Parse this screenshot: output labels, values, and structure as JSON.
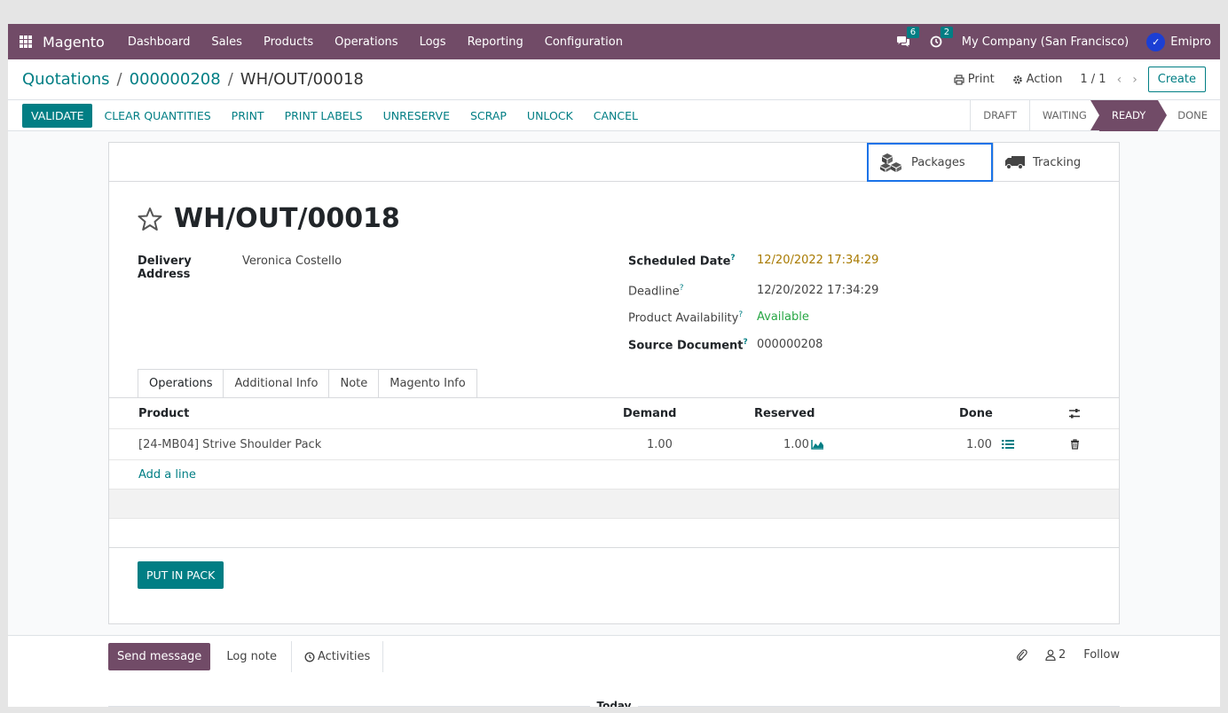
{
  "navbar": {
    "brand": "Magento",
    "menu": [
      "Dashboard",
      "Sales",
      "Products",
      "Operations",
      "Logs",
      "Reporting",
      "Configuration"
    ],
    "messages_count": "6",
    "activities_count": "2",
    "company": "My Company (San Francisco)",
    "user": "Emipro"
  },
  "breadcrumb": {
    "items": [
      "Quotations",
      "000000208"
    ],
    "current": "WH/OUT/00018"
  },
  "control": {
    "print_label": "Print",
    "action_label": "Action",
    "pager": "1 / 1",
    "create_label": "Create"
  },
  "statusbar": {
    "buttons": [
      "CLEAR QUANTITIES",
      "PRINT",
      "PRINT LABELS",
      "UNRESERVE",
      "SCRAP",
      "UNLOCK",
      "CANCEL"
    ],
    "primary": "VALIDATE",
    "stages": [
      "DRAFT",
      "WAITING",
      "READY",
      "DONE"
    ],
    "active_stage": "READY"
  },
  "smart_buttons": {
    "packages": "Packages",
    "tracking": "Tracking"
  },
  "record": {
    "title": "WH/OUT/00018",
    "delivery_address_label": "Delivery Address",
    "delivery_address": "Veronica Costello",
    "scheduled_date_label": "Scheduled Date",
    "scheduled_date": "12/20/2022 17:34:29",
    "deadline_label": "Deadline",
    "deadline": "12/20/2022 17:34:29",
    "availability_label": "Product Availability",
    "availability": "Available",
    "source_label": "Source Document",
    "source": "000000208",
    "help_mark": "?"
  },
  "tabs": [
    "Operations",
    "Additional Info",
    "Note",
    "Magento Info"
  ],
  "table": {
    "headers": {
      "product": "Product",
      "demand": "Demand",
      "reserved": "Reserved",
      "done": "Done"
    },
    "rows": [
      {
        "product": "[24-MB04] Strive Shoulder Pack",
        "demand": "1.00",
        "reserved": "1.00",
        "done": "1.00"
      }
    ],
    "add_line": "Add a line"
  },
  "put_in_pack": "PUT IN PACK",
  "chatter": {
    "send_message": "Send message",
    "log_note": "Log note",
    "activities": "Activities",
    "followers_count": "2",
    "follow": "Follow",
    "today": "Today"
  },
  "colors": {
    "brand": "#714b67",
    "accent": "#017e84",
    "warning": "#a87a00",
    "success": "#28a745"
  }
}
